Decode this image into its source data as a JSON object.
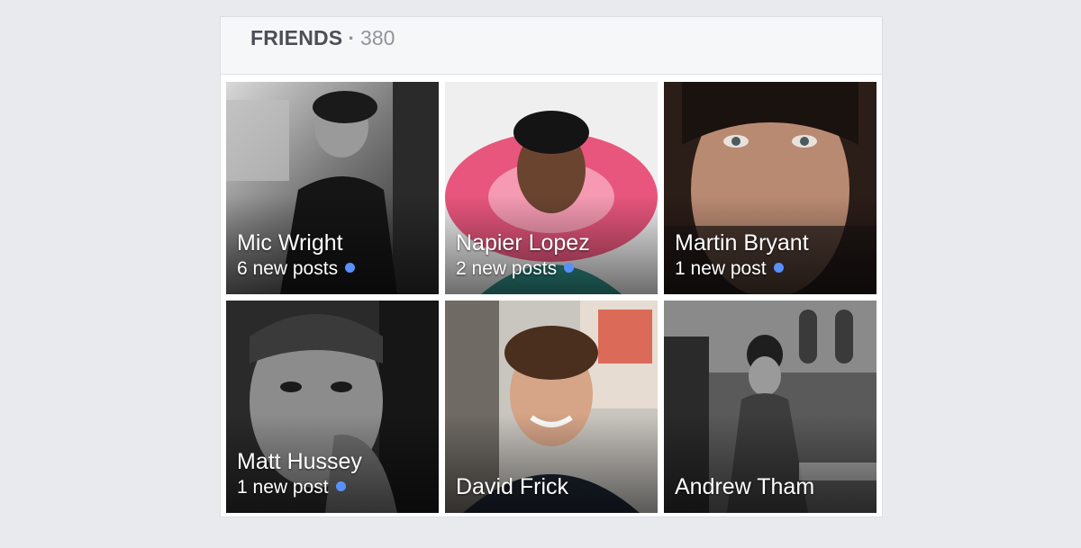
{
  "friends": {
    "label": "FRIENDS",
    "separator": "·",
    "count": "380"
  },
  "colors": {
    "unread_dot": "#5890ff",
    "header_text": "#4b4f56",
    "count_text": "#90949c"
  },
  "tiles": [
    {
      "name": "Mic Wright",
      "posts": "6 new posts"
    },
    {
      "name": "Napier Lopez",
      "posts": "2 new posts"
    },
    {
      "name": "Martin Bryant",
      "posts": "1 new post"
    },
    {
      "name": "Matt Hussey",
      "posts": "1 new post"
    },
    {
      "name": "David Frick"
    },
    {
      "name": "Andrew Tham"
    }
  ]
}
